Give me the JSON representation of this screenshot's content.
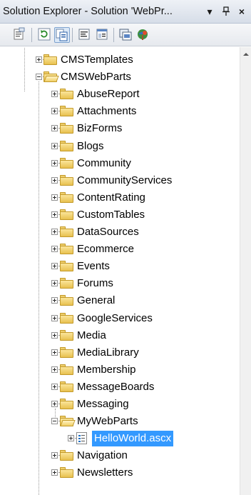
{
  "window": {
    "title": "Solution Explorer - Solution 'WebPr...",
    "dropdown_glyph": "▾",
    "pin_glyph": "⊥",
    "close_glyph": "×"
  },
  "toolbar": {
    "buttons": [
      {
        "name": "properties-icon",
        "pressed": false
      },
      {
        "name": "refresh-icon",
        "pressed": false
      },
      {
        "name": "show-all-files-icon",
        "pressed": true
      },
      {
        "name": "view-code-icon",
        "pressed": false
      },
      {
        "name": "view-designer-icon",
        "pressed": false
      },
      {
        "name": "copy-website-icon",
        "pressed": false
      },
      {
        "name": "aspnet-configuration-icon",
        "pressed": false
      }
    ]
  },
  "tree": {
    "items": [
      {
        "label": "CMSTemplates",
        "level": 0,
        "type": "folder",
        "state": "collapsed"
      },
      {
        "label": "CMSWebParts",
        "level": 0,
        "type": "folder",
        "state": "expanded"
      },
      {
        "label": "AbuseReport",
        "level": 1,
        "type": "folder",
        "state": "collapsed"
      },
      {
        "label": "Attachments",
        "level": 1,
        "type": "folder",
        "state": "collapsed"
      },
      {
        "label": "BizForms",
        "level": 1,
        "type": "folder",
        "state": "collapsed"
      },
      {
        "label": "Blogs",
        "level": 1,
        "type": "folder",
        "state": "collapsed"
      },
      {
        "label": "Community",
        "level": 1,
        "type": "folder",
        "state": "collapsed"
      },
      {
        "label": "CommunityServices",
        "level": 1,
        "type": "folder",
        "state": "collapsed"
      },
      {
        "label": "ContentRating",
        "level": 1,
        "type": "folder",
        "state": "collapsed"
      },
      {
        "label": "CustomTables",
        "level": 1,
        "type": "folder",
        "state": "collapsed"
      },
      {
        "label": "DataSources",
        "level": 1,
        "type": "folder",
        "state": "collapsed"
      },
      {
        "label": "Ecommerce",
        "level": 1,
        "type": "folder",
        "state": "collapsed"
      },
      {
        "label": "Events",
        "level": 1,
        "type": "folder",
        "state": "collapsed"
      },
      {
        "label": "Forums",
        "level": 1,
        "type": "folder",
        "state": "collapsed"
      },
      {
        "label": "General",
        "level": 1,
        "type": "folder",
        "state": "collapsed"
      },
      {
        "label": "GoogleServices",
        "level": 1,
        "type": "folder",
        "state": "collapsed"
      },
      {
        "label": "Media",
        "level": 1,
        "type": "folder",
        "state": "collapsed"
      },
      {
        "label": "MediaLibrary",
        "level": 1,
        "type": "folder",
        "state": "collapsed"
      },
      {
        "label": "Membership",
        "level": 1,
        "type": "folder",
        "state": "collapsed"
      },
      {
        "label": "MessageBoards",
        "level": 1,
        "type": "folder",
        "state": "collapsed"
      },
      {
        "label": "Messaging",
        "level": 1,
        "type": "folder",
        "state": "collapsed"
      },
      {
        "label": "MyWebParts",
        "level": 1,
        "type": "folder",
        "state": "expanded"
      },
      {
        "label": "HelloWorld.ascx",
        "level": 2,
        "type": "file",
        "state": "collapsed",
        "selected": true
      },
      {
        "label": "Navigation",
        "level": 1,
        "type": "folder",
        "state": "collapsed"
      },
      {
        "label": "Newsletters",
        "level": 1,
        "type": "folder",
        "state": "collapsed"
      }
    ]
  },
  "colors": {
    "selection": "#3399ff",
    "folder": "#f0cf66",
    "titlebar": "#d6dde8"
  }
}
